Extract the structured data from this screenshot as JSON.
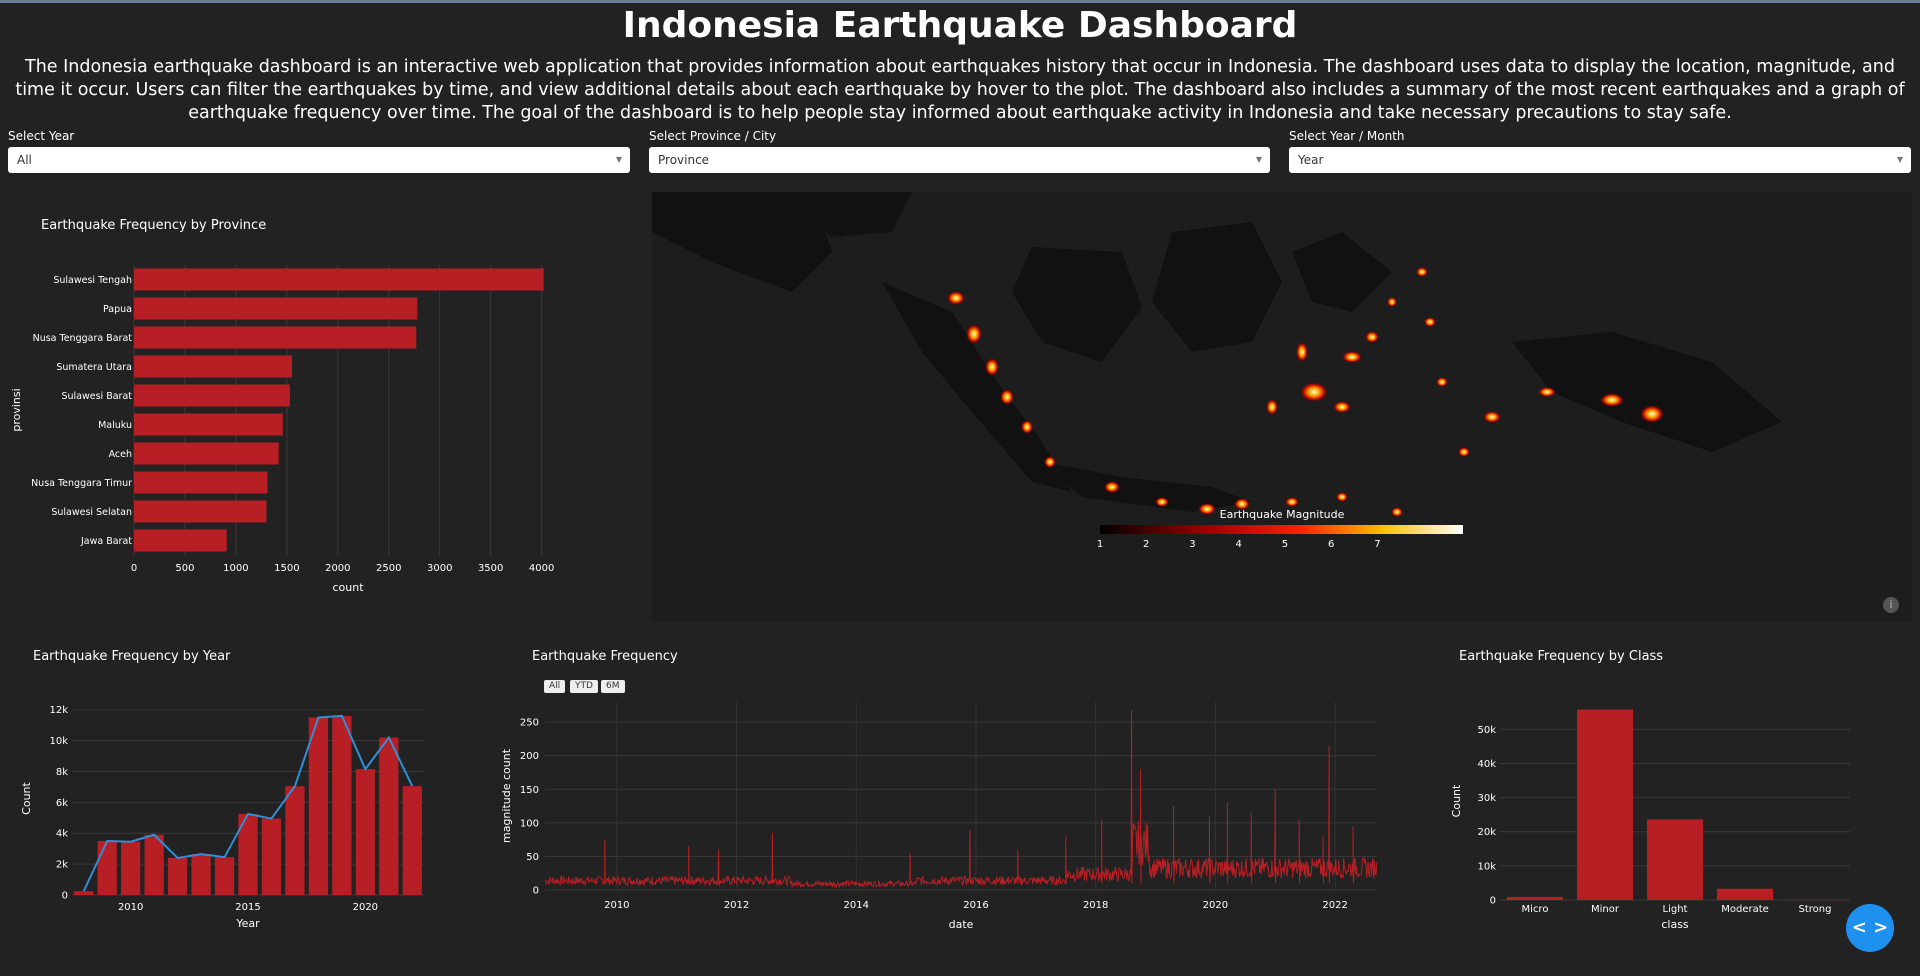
{
  "header": {
    "title": "Indonesia Earthquake Dashboard",
    "description": "The Indonesia earthquake dashboard is an interactive web application that provides information about earthquakes history that occur in Indonesia. The dashboard uses data to display the location, magnitude, and time it occur. Users can filter the earthquakes by time, and view additional details about each earthquake by hover to the plot. The dashboard also includes a summary of the most recent earthquakes and a graph of earthquake frequency over time. The goal of the dashboard is to help people stay informed about earthquake activity in Indonesia and take necessary precautions to stay safe."
  },
  "filters": {
    "year": {
      "label": "Select Year",
      "value": "All"
    },
    "province": {
      "label": "Select Province / City",
      "value": "Province"
    },
    "period": {
      "label": "Select Year / Month",
      "value": "Year"
    }
  },
  "colors": {
    "bar": "#b71f24",
    "line": "#2f8fd8",
    "background": "#222222"
  },
  "map": {
    "colorbar_title": "Earthquake Magnitude",
    "colorbar_ticks": [
      "1",
      "2",
      "3",
      "4",
      "5",
      "6",
      "7"
    ],
    "info_icon": "info-icon"
  },
  "range_buttons": [
    "All",
    "YTD",
    "6M"
  ],
  "fab": {
    "icon": "code-icon",
    "label": "< >"
  },
  "chart_data": [
    {
      "type": "bar",
      "orientation": "horizontal",
      "title": "Earthquake Frequency by Province",
      "xlabel": "count",
      "ylabel": "provinsi",
      "categories": [
        "Sulawesi Tengah",
        "Papua",
        "Nusa Tenggara Barat",
        "Sumatera Utara",
        "Sulawesi Barat",
        "Maluku",
        "Aceh",
        "Nusa Tenggara Timur",
        "Sulawesi Selatan",
        "Jawa Barat"
      ],
      "values": [
        4020,
        2780,
        2770,
        1550,
        1530,
        1460,
        1420,
        1310,
        1300,
        910
      ],
      "xlim": [
        0,
        4200
      ],
      "xticks": [
        "0",
        "500",
        "1000",
        "1500",
        "2000",
        "2500",
        "3000",
        "3500",
        "4000"
      ]
    },
    {
      "type": "bar",
      "title": "Earthquake Frequency by Year",
      "xlabel": "Year",
      "ylabel": "Count",
      "x": [
        2008,
        2009,
        2010,
        2011,
        2012,
        2013,
        2014,
        2015,
        2016,
        2017,
        2018,
        2019,
        2020,
        2021,
        2022
      ],
      "values": [
        250,
        3500,
        3450,
        3900,
        2400,
        2650,
        2450,
        5250,
        4950,
        7050,
        11500,
        11600,
        8150,
        10200,
        7050
      ],
      "line_values": [
        250,
        3500,
        3450,
        3900,
        2400,
        2650,
        2450,
        5250,
        4950,
        7050,
        11500,
        11600,
        8150,
        10200,
        7050
      ],
      "ylim": [
        0,
        12500
      ],
      "yticks": [
        "0",
        "2k",
        "4k",
        "6k",
        "8k",
        "10k",
        "12k"
      ],
      "xticks": [
        "2010",
        "2015",
        "2020"
      ]
    },
    {
      "type": "line",
      "title": "Earthquake Frequency",
      "xlabel": "date",
      "ylabel": "magnitude count",
      "xlim": [
        2008.8,
        2022.7
      ],
      "ylim": [
        0,
        280
      ],
      "xticks": [
        "2010",
        "2012",
        "2014",
        "2016",
        "2018",
        "2020",
        "2022"
      ],
      "yticks": [
        "0",
        "50",
        "100",
        "150",
        "200",
        "250"
      ],
      "spikes": [
        {
          "x": 2009.8,
          "y": 75
        },
        {
          "x": 2011.2,
          "y": 65
        },
        {
          "x": 2011.7,
          "y": 60
        },
        {
          "x": 2012.6,
          "y": 85
        },
        {
          "x": 2014.9,
          "y": 55
        },
        {
          "x": 2015.9,
          "y": 90
        },
        {
          "x": 2016.7,
          "y": 60
        },
        {
          "x": 2017.5,
          "y": 80
        },
        {
          "x": 2018.1,
          "y": 105
        },
        {
          "x": 2018.6,
          "y": 268
        },
        {
          "x": 2018.75,
          "y": 180
        },
        {
          "x": 2019.3,
          "y": 125
        },
        {
          "x": 2019.9,
          "y": 110
        },
        {
          "x": 2020.2,
          "y": 130
        },
        {
          "x": 2020.6,
          "y": 115
        },
        {
          "x": 2021.0,
          "y": 150
        },
        {
          "x": 2021.4,
          "y": 105
        },
        {
          "x": 2021.8,
          "y": 80
        },
        {
          "x": 2021.9,
          "y": 215
        },
        {
          "x": 2022.3,
          "y": 95
        }
      ]
    },
    {
      "type": "bar",
      "title": "Earthquake Frequency by Class",
      "xlabel": "class",
      "ylabel": "Count",
      "categories": [
        "Micro",
        "Minor",
        "Light",
        "Moderate",
        "Strong"
      ],
      "values": [
        900,
        55800,
        23600,
        3300,
        40
      ],
      "ylim": [
        0,
        58000
      ],
      "yticks": [
        "0",
        "10k",
        "20k",
        "30k",
        "40k",
        "50k"
      ]
    }
  ]
}
